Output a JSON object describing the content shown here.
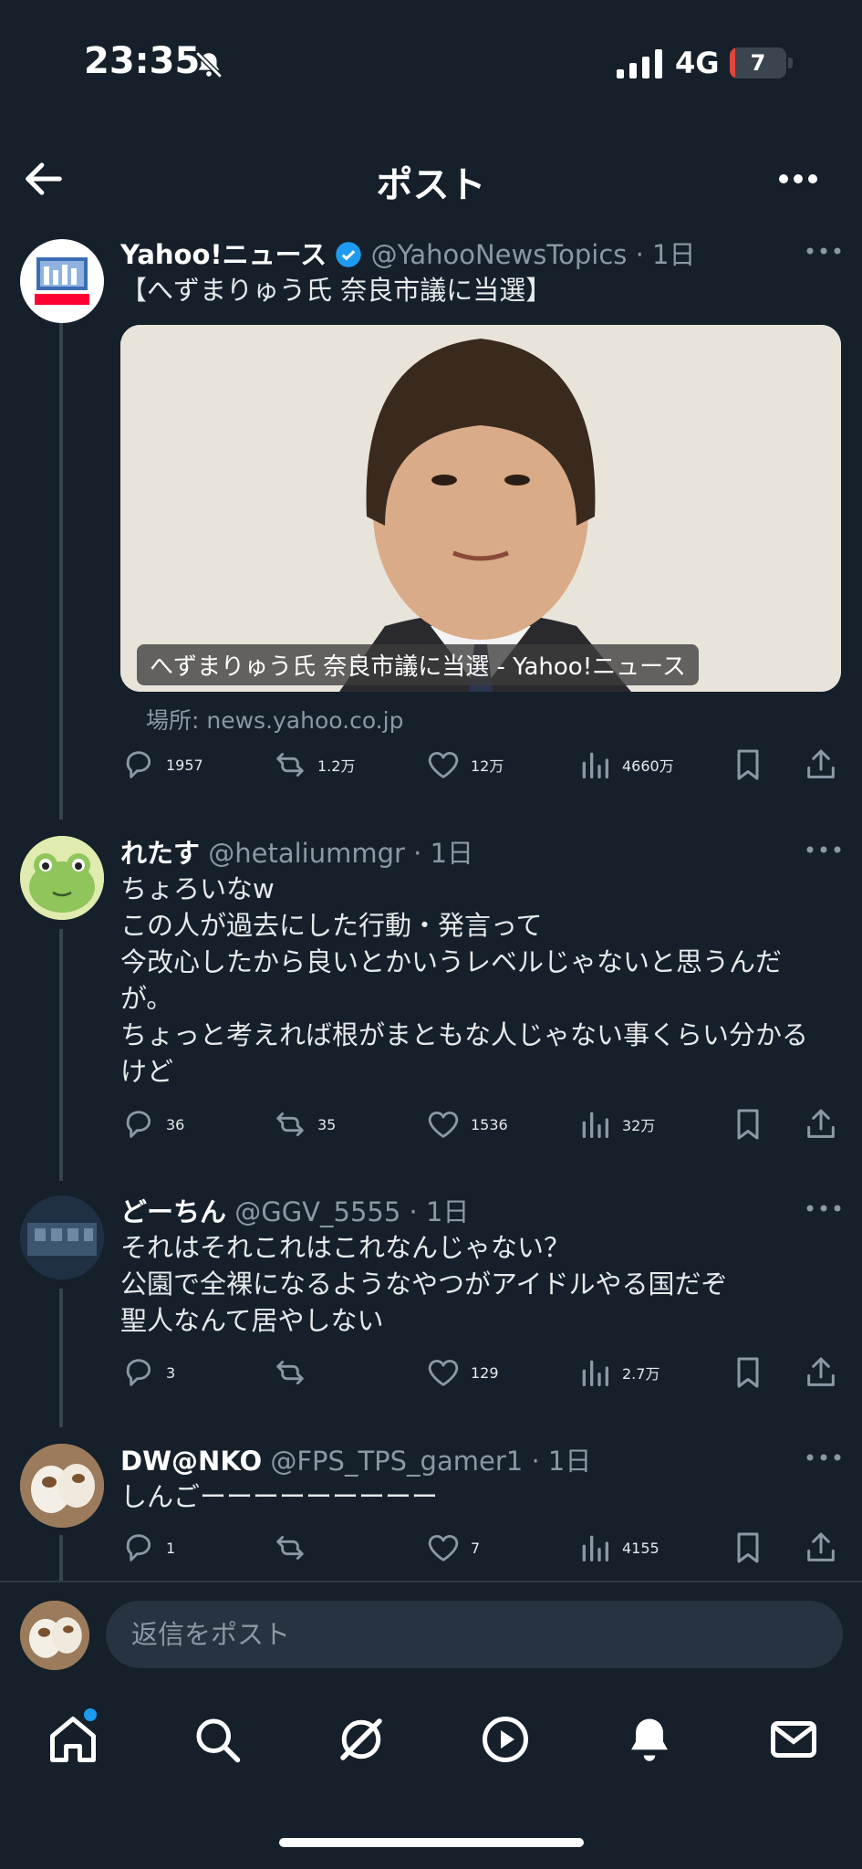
{
  "status": {
    "time": "23:35",
    "network": "4G",
    "battery": "7"
  },
  "header": {
    "title": "ポスト"
  },
  "main_post": {
    "name": "Yahoo!ニュース",
    "handle": "@YahooNewsTopics",
    "time": "· 1日",
    "text": "【へずまりゅう氏 奈良市議に当選】",
    "media_caption": "へずまりゅう氏 奈良市議に当選 - Yahoo!ニュース",
    "source": "場所: news.yahoo.co.jp",
    "replies": "1957",
    "reposts": "1.2万",
    "likes": "12万",
    "views": "4660万"
  },
  "replies": [
    {
      "name": "れたす",
      "handle": "@hetaliummgr",
      "time": "· 1日",
      "text": "ちょろいなw\nこの人が過去にした行動・発言って\n今改心したから良いとかいうレベルじゃないと思うんだが。\nちょっと考えれば根がまともな人じゃない事くらい分かるけど",
      "replies": "36",
      "reposts": "35",
      "likes": "1536",
      "views": "32万"
    },
    {
      "name": "どーちん",
      "handle": "@GGV_5555",
      "time": "· 1日",
      "text": "それはそれこれはこれなんじゃない？\n公園で全裸になるようなやつがアイドルやる国だぞ\n聖人なんて居やしない",
      "replies": "3",
      "reposts": "",
      "likes": "129",
      "views": "2.7万"
    },
    {
      "name": "DW@NKO",
      "handle": "@FPS_TPS_gamer1",
      "time": "· 1日",
      "text": "しんごーーーーーーーーー",
      "replies": "1",
      "reposts": "",
      "likes": "7",
      "views": "4155"
    }
  ],
  "reply_bar": {
    "placeholder": "返信をポスト"
  },
  "nav": [
    "home-icon",
    "search-icon",
    "grok-icon",
    "video-icon",
    "notifications-icon",
    "messages-icon"
  ],
  "colors": {
    "background": "#15202b",
    "accent": "#1d9bf0",
    "muted": "#8b98a5"
  }
}
